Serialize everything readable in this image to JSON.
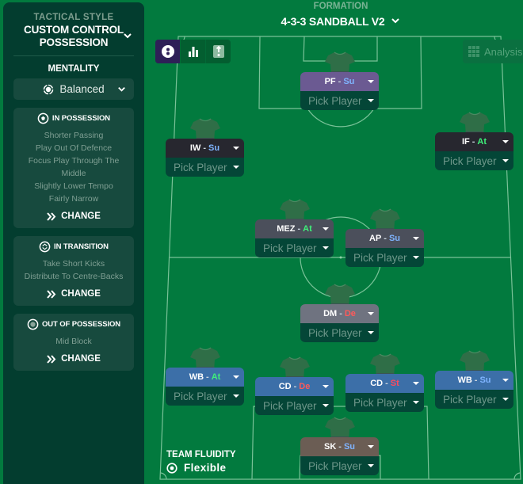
{
  "sidebar": {
    "tactical_style_label": "TACTICAL STYLE",
    "tactical_style_line1": "CUSTOM CONTROL",
    "tactical_style_line2": "POSSESSION",
    "mentality_label": "MENTALITY",
    "mentality_value": "Balanced",
    "phases": [
      {
        "title": "IN POSSESSION",
        "icon": "ball-icon",
        "instructions": [
          "Shorter Passing",
          "Play Out Of Defence",
          "Focus Play Through The",
          "Middle",
          "Slightly Lower Tempo",
          "Fairly Narrow"
        ],
        "action_label": "CHANGE"
      },
      {
        "title": "IN TRANSITION",
        "icon": "transition-icon",
        "instructions": [
          "Take Short Kicks",
          "Distribute To Centre-Backs"
        ],
        "action_label": "CHANGE"
      },
      {
        "title": "OUT OF POSSESSION",
        "icon": "defend-icon",
        "instructions": [
          "Mid Block"
        ],
        "action_label": "CHANGE"
      }
    ]
  },
  "formation": {
    "label": "FORMATION",
    "name": "4-3-3 SANDBALL V2"
  },
  "toolbar": {
    "analysis_label": "Analysis"
  },
  "players": [
    {
      "role": "PF",
      "duty": "Su",
      "pick_label": "Pick Player",
      "color": "#6b5a92"
    },
    {
      "role": "IW",
      "duty": "Su",
      "pick_label": "Pick Player",
      "color": "#27272f"
    },
    {
      "role": "IF",
      "duty": "At",
      "pick_label": "Pick Player",
      "color": "#27272f"
    },
    {
      "role": "MEZ",
      "duty": "At",
      "pick_label": "Pick Player",
      "color": "#4b4f5b"
    },
    {
      "role": "AP",
      "duty": "Su",
      "pick_label": "Pick Player",
      "color": "#4b4f5b"
    },
    {
      "role": "DM",
      "duty": "De",
      "pick_label": "Pick Player",
      "color": "#6f7380"
    },
    {
      "role": "WB",
      "duty": "At",
      "pick_label": "Pick Player",
      "color": "#3c6fa8"
    },
    {
      "role": "CD",
      "duty": "De",
      "pick_label": "Pick Player",
      "color": "#3c6fa8"
    },
    {
      "role": "CD",
      "duty": "St",
      "pick_label": "Pick Player",
      "color": "#3c6fa8"
    },
    {
      "role": "WB",
      "duty": "Su",
      "pick_label": "Pick Player",
      "color": "#3c6fa8"
    },
    {
      "role": "SK",
      "duty": "Su",
      "pick_label": "Pick Player",
      "color": "#6b5d54"
    }
  ],
  "team_fluidity": {
    "label": "TEAM FLUIDITY",
    "value": "Flexible"
  }
}
